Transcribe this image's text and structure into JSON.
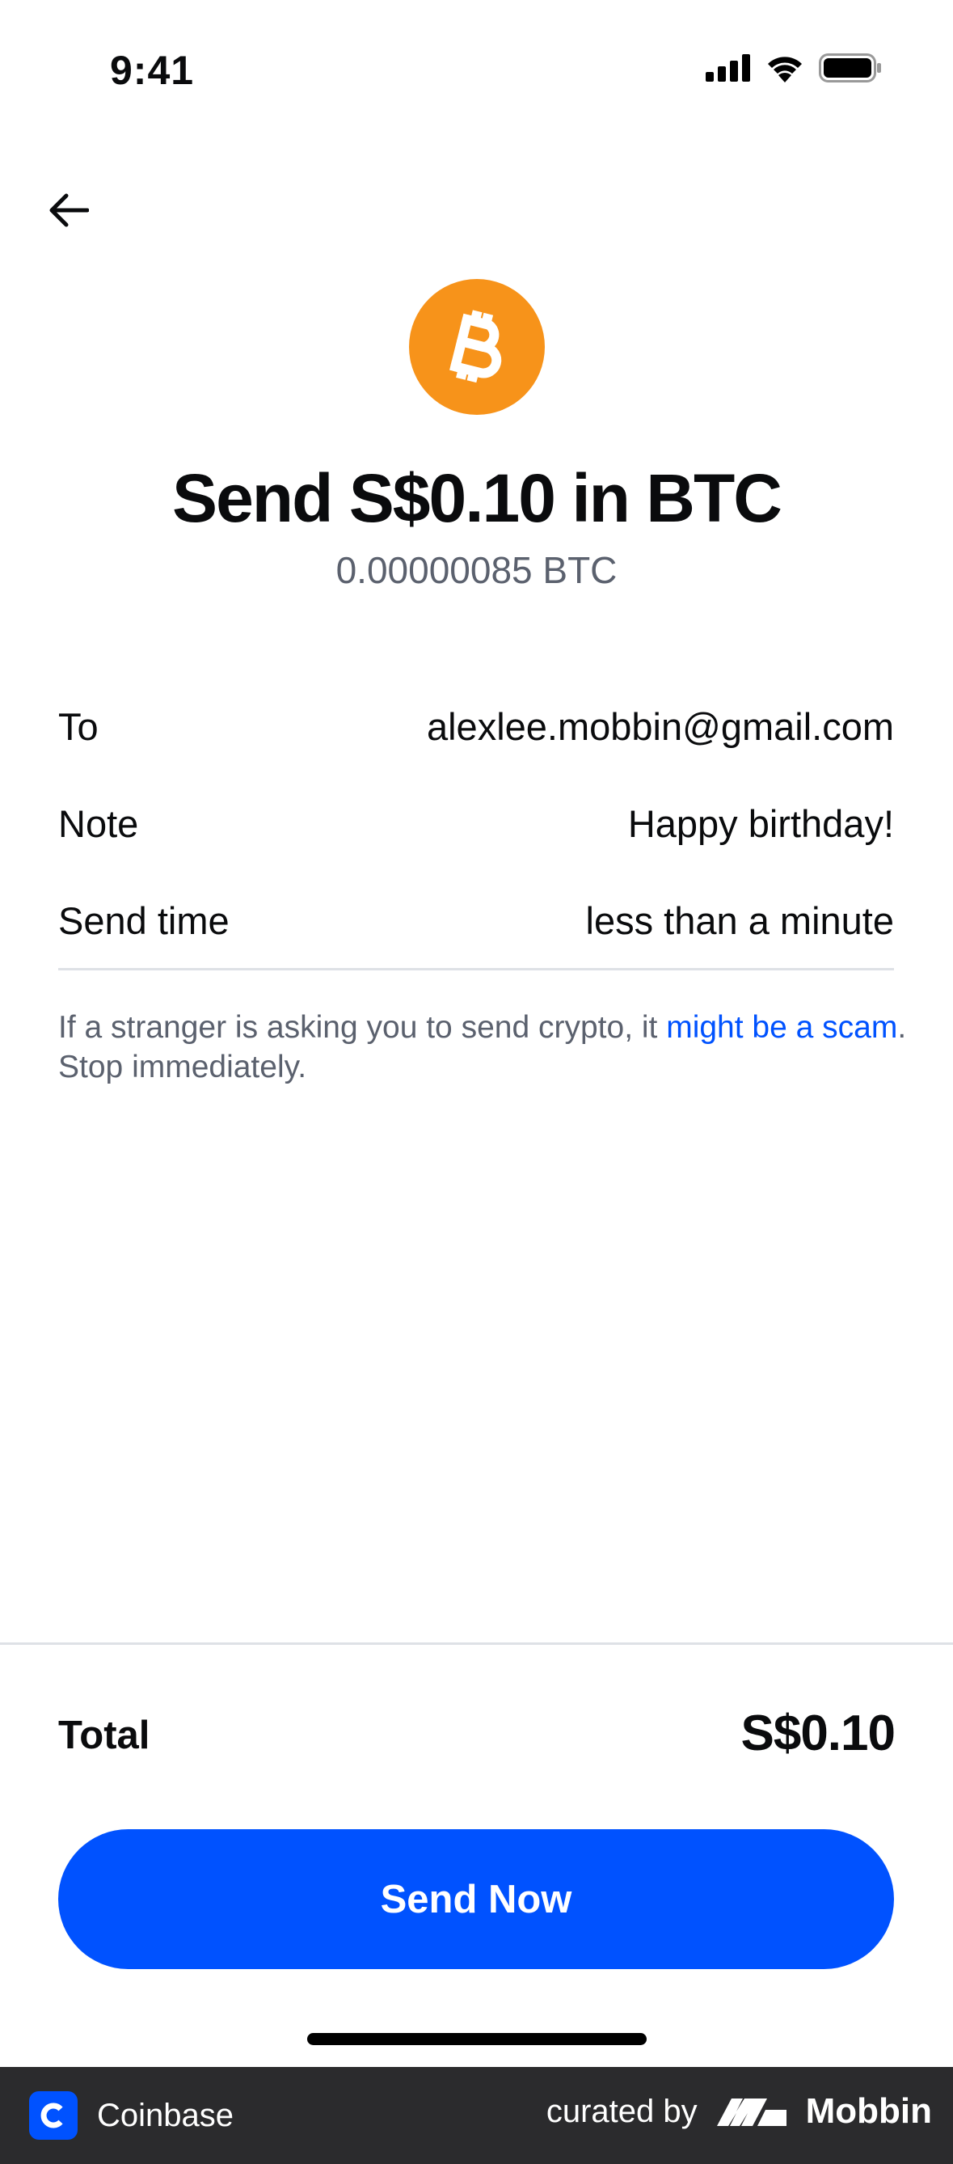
{
  "status_bar": {
    "time": "9:41"
  },
  "header": {
    "title": "Send S$0.10 in BTC",
    "subtitle": "0.00000085 BTC"
  },
  "details": [
    {
      "label": "To",
      "value": "alexlee.mobbin@gmail.com"
    },
    {
      "label": "Note",
      "value": "Happy birthday!"
    },
    {
      "label": "Send time",
      "value": "less than a minute"
    }
  ],
  "warning": {
    "text_before": "If a stranger is asking you to send crypto, it ",
    "link_text": "might be a scam",
    "text_after": ". Stop immediately."
  },
  "total": {
    "label": "Total",
    "value": "S$0.10"
  },
  "primary_button": {
    "label": "Send Now"
  },
  "brand_bar": {
    "app_name": "Coinbase",
    "curated_by": "curated by",
    "curator": "Mobbin"
  },
  "colors": {
    "accent": "#0052ff",
    "bitcoin": "#f7931a",
    "muted_text": "#5b616e"
  },
  "icons": [
    "back-arrow-icon",
    "bitcoin-icon",
    "signal-icon",
    "wifi-icon",
    "battery-icon",
    "coinbase-logo-icon",
    "mobbin-logo-icon"
  ]
}
